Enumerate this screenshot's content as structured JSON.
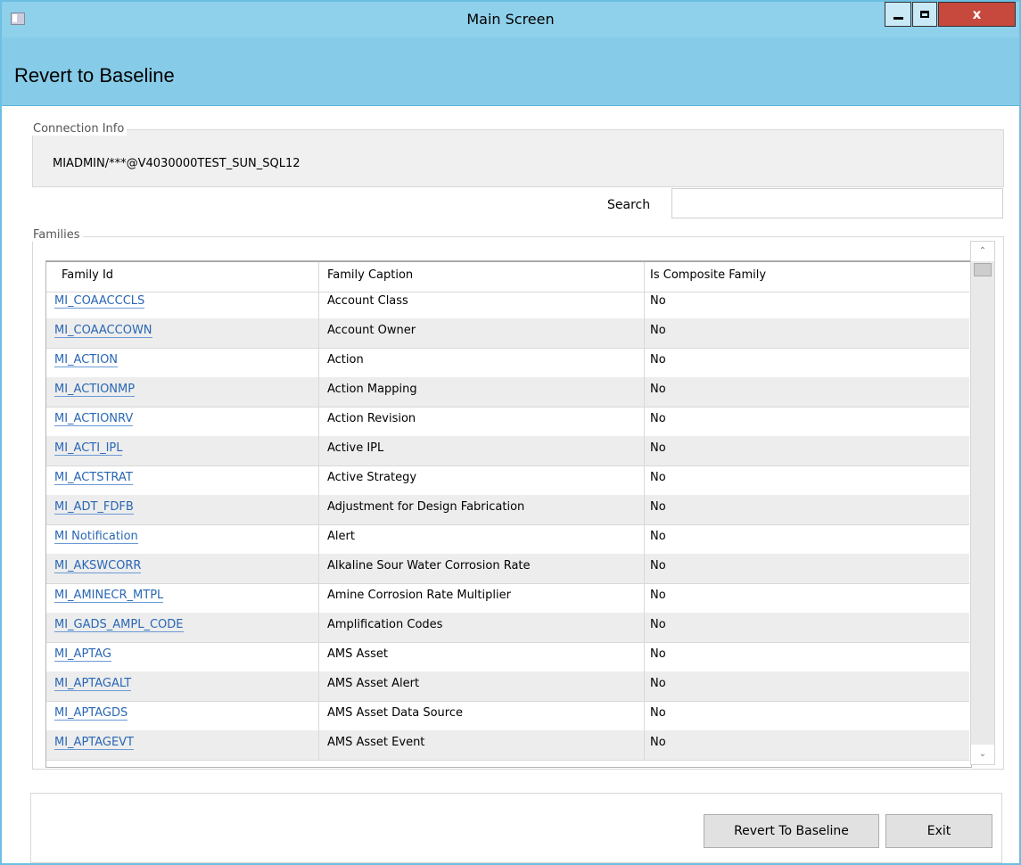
{
  "window": {
    "title": "Main Screen",
    "close_glyph": "x"
  },
  "header": {
    "title": "Revert to Baseline"
  },
  "connection": {
    "legend": "Connection Info",
    "value": "MIADMIN/***@V4030000TEST_SUN_SQL12"
  },
  "search": {
    "label": "Search",
    "value": ""
  },
  "families": {
    "legend": "Families",
    "columns": [
      "Family Id",
      "Family Caption",
      "Is Composite Family"
    ],
    "rows": [
      {
        "id": "MI_COAACCCLS",
        "caption": "Account Class",
        "composite": "No"
      },
      {
        "id": "MI_COAACCOWN",
        "caption": "Account Owner",
        "composite": "No"
      },
      {
        "id": "MI_ACTION",
        "caption": "Action",
        "composite": "No"
      },
      {
        "id": "MI_ACTIONMP",
        "caption": "Action Mapping",
        "composite": "No"
      },
      {
        "id": "MI_ACTIONRV",
        "caption": "Action Revision",
        "composite": "No"
      },
      {
        "id": "MI_ACTI_IPL",
        "caption": "Active IPL",
        "composite": "No"
      },
      {
        "id": "MI_ACTSTRAT",
        "caption": "Active Strategy",
        "composite": "No"
      },
      {
        "id": "MI_ADT_FDFB",
        "caption": "Adjustment for Design Fabrication",
        "composite": "No"
      },
      {
        "id": "MI Notification",
        "caption": "Alert",
        "composite": "No"
      },
      {
        "id": "MI_AKSWCORR",
        "caption": "Alkaline Sour Water Corrosion Rate",
        "composite": "No"
      },
      {
        "id": "MI_AMINECR_MTPL",
        "caption": "Amine Corrosion Rate Multiplier",
        "composite": "No"
      },
      {
        "id": "MI_GADS_AMPL_CODE",
        "caption": "Amplification Codes",
        "composite": "No"
      },
      {
        "id": "MI_APTAG",
        "caption": "AMS Asset",
        "composite": "No"
      },
      {
        "id": "MI_APTAGALT",
        "caption": "AMS Asset Alert",
        "composite": "No"
      },
      {
        "id": "MI_APTAGDS",
        "caption": "AMS Asset Data Source",
        "composite": "No"
      },
      {
        "id": "MI_APTAGEVT",
        "caption": "AMS Asset Event",
        "composite": "No"
      }
    ]
  },
  "buttons": {
    "revert": "Revert To Baseline",
    "exit": "Exit"
  },
  "colors": {
    "title_bar": "#8fd0ea",
    "header": "#86cce8",
    "close_button": "#c7483c",
    "link": "#2967b5"
  }
}
